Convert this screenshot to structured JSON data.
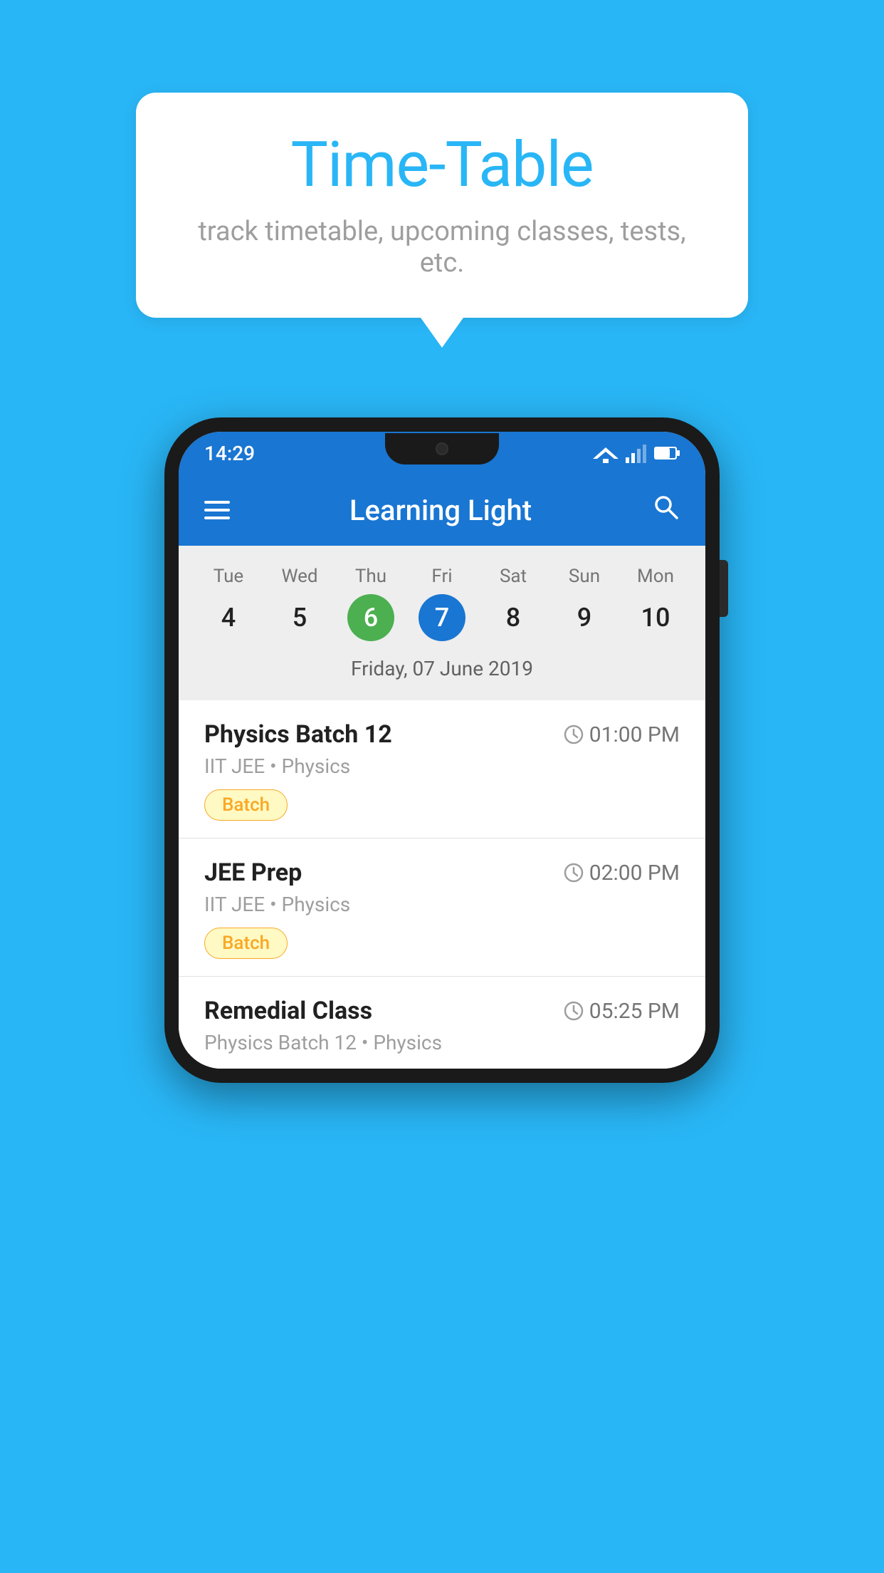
{
  "background_color": "#29B6F6",
  "speech_bubble": {
    "title": "Time-Table",
    "subtitle": "track timetable, upcoming classes, tests, etc."
  },
  "phone": {
    "status_bar": {
      "time": "14:29"
    },
    "app_bar": {
      "title": "Learning Light"
    },
    "calendar": {
      "days": [
        {
          "label": "Tue",
          "number": "4",
          "state": "normal"
        },
        {
          "label": "Wed",
          "number": "5",
          "state": "normal"
        },
        {
          "label": "Thu",
          "number": "6",
          "state": "today"
        },
        {
          "label": "Fri",
          "number": "7",
          "state": "selected"
        },
        {
          "label": "Sat",
          "number": "8",
          "state": "normal"
        },
        {
          "label": "Sun",
          "number": "9",
          "state": "normal"
        },
        {
          "label": "Mon",
          "number": "10",
          "state": "normal"
        }
      ],
      "selected_date_label": "Friday, 07 June 2019"
    },
    "schedule_items": [
      {
        "title": "Physics Batch 12",
        "time": "01:00 PM",
        "subtitle": "IIT JEE • Physics",
        "tag": "Batch"
      },
      {
        "title": "JEE Prep",
        "time": "02:00 PM",
        "subtitle": "IIT JEE • Physics",
        "tag": "Batch"
      },
      {
        "title": "Remedial Class",
        "time": "05:25 PM",
        "subtitle": "Physics Batch 12 • Physics",
        "tag": null,
        "partial": true
      }
    ]
  }
}
